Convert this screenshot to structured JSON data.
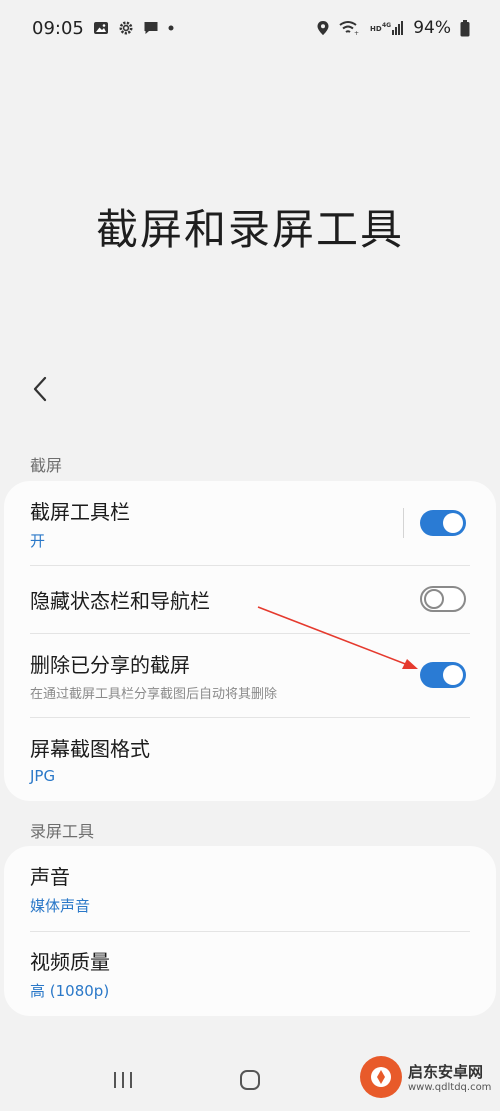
{
  "status_bar": {
    "time": "09:05",
    "battery": "94%"
  },
  "page": {
    "title": "截屏和录屏工具"
  },
  "sections": {
    "screenshot": {
      "label": "截屏",
      "items": [
        {
          "title": "截屏工具栏",
          "subtitle": "开",
          "toggle": true
        },
        {
          "title": "隐藏状态栏和导航栏",
          "toggle": false
        },
        {
          "title": "删除已分享的截屏",
          "description": "在通过截屏工具栏分享截图后自动将其删除",
          "toggle": true
        },
        {
          "title": "屏幕截图格式",
          "subtitle": "JPG"
        }
      ]
    },
    "recording": {
      "label": "录屏工具",
      "items": [
        {
          "title": "声音",
          "subtitle": "媒体声音"
        },
        {
          "title": "视频质量",
          "subtitle": "高 (1080p)"
        }
      ]
    }
  },
  "watermark": {
    "name": "启东安卓网",
    "url": "www.qdltdq.com"
  },
  "colors": {
    "accent": "#2a7bd4",
    "annotation_arrow": "#e53a2e",
    "background": "#f2f2f2"
  },
  "icons": [
    "image-icon",
    "gear-icon",
    "message-icon",
    "location-icon",
    "wifi-icon",
    "signal-icon",
    "battery-icon",
    "back-arrow-icon",
    "recents-icon",
    "home-icon"
  ]
}
